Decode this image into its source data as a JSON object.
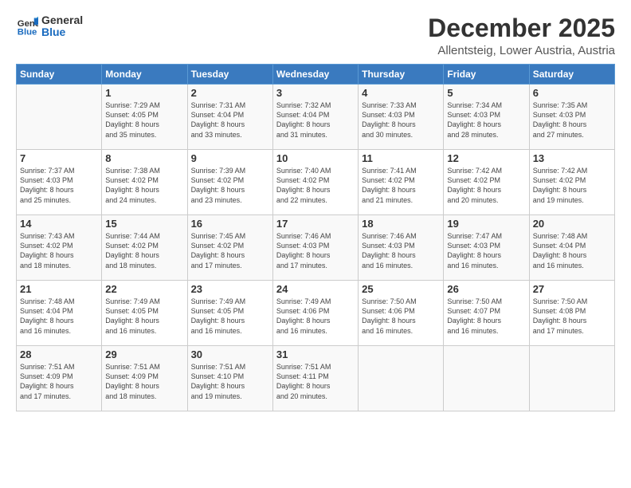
{
  "logo": {
    "line1": "General",
    "line2": "Blue"
  },
  "title": "December 2025",
  "location": "Allentsteig, Lower Austria, Austria",
  "weekdays": [
    "Sunday",
    "Monday",
    "Tuesday",
    "Wednesday",
    "Thursday",
    "Friday",
    "Saturday"
  ],
  "weeks": [
    [
      {
        "num": "",
        "info": ""
      },
      {
        "num": "1",
        "info": "Sunrise: 7:29 AM\nSunset: 4:05 PM\nDaylight: 8 hours\nand 35 minutes."
      },
      {
        "num": "2",
        "info": "Sunrise: 7:31 AM\nSunset: 4:04 PM\nDaylight: 8 hours\nand 33 minutes."
      },
      {
        "num": "3",
        "info": "Sunrise: 7:32 AM\nSunset: 4:04 PM\nDaylight: 8 hours\nand 31 minutes."
      },
      {
        "num": "4",
        "info": "Sunrise: 7:33 AM\nSunset: 4:03 PM\nDaylight: 8 hours\nand 30 minutes."
      },
      {
        "num": "5",
        "info": "Sunrise: 7:34 AM\nSunset: 4:03 PM\nDaylight: 8 hours\nand 28 minutes."
      },
      {
        "num": "6",
        "info": "Sunrise: 7:35 AM\nSunset: 4:03 PM\nDaylight: 8 hours\nand 27 minutes."
      }
    ],
    [
      {
        "num": "7",
        "info": "Sunrise: 7:37 AM\nSunset: 4:03 PM\nDaylight: 8 hours\nand 25 minutes."
      },
      {
        "num": "8",
        "info": "Sunrise: 7:38 AM\nSunset: 4:02 PM\nDaylight: 8 hours\nand 24 minutes."
      },
      {
        "num": "9",
        "info": "Sunrise: 7:39 AM\nSunset: 4:02 PM\nDaylight: 8 hours\nand 23 minutes."
      },
      {
        "num": "10",
        "info": "Sunrise: 7:40 AM\nSunset: 4:02 PM\nDaylight: 8 hours\nand 22 minutes."
      },
      {
        "num": "11",
        "info": "Sunrise: 7:41 AM\nSunset: 4:02 PM\nDaylight: 8 hours\nand 21 minutes."
      },
      {
        "num": "12",
        "info": "Sunrise: 7:42 AM\nSunset: 4:02 PM\nDaylight: 8 hours\nand 20 minutes."
      },
      {
        "num": "13",
        "info": "Sunrise: 7:42 AM\nSunset: 4:02 PM\nDaylight: 8 hours\nand 19 minutes."
      }
    ],
    [
      {
        "num": "14",
        "info": "Sunrise: 7:43 AM\nSunset: 4:02 PM\nDaylight: 8 hours\nand 18 minutes."
      },
      {
        "num": "15",
        "info": "Sunrise: 7:44 AM\nSunset: 4:02 PM\nDaylight: 8 hours\nand 18 minutes."
      },
      {
        "num": "16",
        "info": "Sunrise: 7:45 AM\nSunset: 4:02 PM\nDaylight: 8 hours\nand 17 minutes."
      },
      {
        "num": "17",
        "info": "Sunrise: 7:46 AM\nSunset: 4:03 PM\nDaylight: 8 hours\nand 17 minutes."
      },
      {
        "num": "18",
        "info": "Sunrise: 7:46 AM\nSunset: 4:03 PM\nDaylight: 8 hours\nand 16 minutes."
      },
      {
        "num": "19",
        "info": "Sunrise: 7:47 AM\nSunset: 4:03 PM\nDaylight: 8 hours\nand 16 minutes."
      },
      {
        "num": "20",
        "info": "Sunrise: 7:48 AM\nSunset: 4:04 PM\nDaylight: 8 hours\nand 16 minutes."
      }
    ],
    [
      {
        "num": "21",
        "info": "Sunrise: 7:48 AM\nSunset: 4:04 PM\nDaylight: 8 hours\nand 16 minutes."
      },
      {
        "num": "22",
        "info": "Sunrise: 7:49 AM\nSunset: 4:05 PM\nDaylight: 8 hours\nand 16 minutes."
      },
      {
        "num": "23",
        "info": "Sunrise: 7:49 AM\nSunset: 4:05 PM\nDaylight: 8 hours\nand 16 minutes."
      },
      {
        "num": "24",
        "info": "Sunrise: 7:49 AM\nSunset: 4:06 PM\nDaylight: 8 hours\nand 16 minutes."
      },
      {
        "num": "25",
        "info": "Sunrise: 7:50 AM\nSunset: 4:06 PM\nDaylight: 8 hours\nand 16 minutes."
      },
      {
        "num": "26",
        "info": "Sunrise: 7:50 AM\nSunset: 4:07 PM\nDaylight: 8 hours\nand 16 minutes."
      },
      {
        "num": "27",
        "info": "Sunrise: 7:50 AM\nSunset: 4:08 PM\nDaylight: 8 hours\nand 17 minutes."
      }
    ],
    [
      {
        "num": "28",
        "info": "Sunrise: 7:51 AM\nSunset: 4:09 PM\nDaylight: 8 hours\nand 17 minutes."
      },
      {
        "num": "29",
        "info": "Sunrise: 7:51 AM\nSunset: 4:09 PM\nDaylight: 8 hours\nand 18 minutes."
      },
      {
        "num": "30",
        "info": "Sunrise: 7:51 AM\nSunset: 4:10 PM\nDaylight: 8 hours\nand 19 minutes."
      },
      {
        "num": "31",
        "info": "Sunrise: 7:51 AM\nSunset: 4:11 PM\nDaylight: 8 hours\nand 20 minutes."
      },
      {
        "num": "",
        "info": ""
      },
      {
        "num": "",
        "info": ""
      },
      {
        "num": "",
        "info": ""
      }
    ]
  ]
}
